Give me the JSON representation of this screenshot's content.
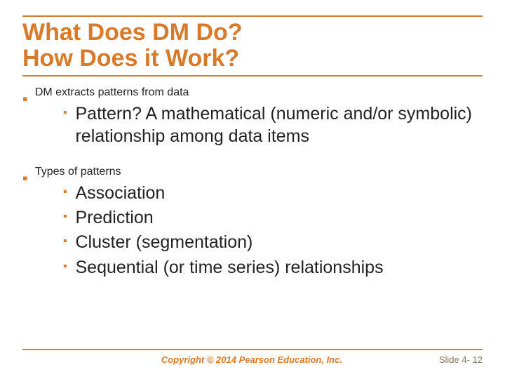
{
  "title_line1": "What Does DM Do?",
  "title_line2": "How Does it Work?",
  "bullets": {
    "b1": "DM extracts patterns from data",
    "b1_sub1": "Pattern? A mathematical (numeric and/or symbolic) relationship among data items",
    "b2": "Types of patterns",
    "b2_sub1": "Association",
    "b2_sub2": "Prediction",
    "b2_sub3": "Cluster (segmentation)",
    "b2_sub4": "Sequential (or time series) relationships"
  },
  "footer": {
    "copyright": "Copyright © 2014 Pearson Education, Inc.",
    "slidenum": "Slide 4- 12"
  }
}
